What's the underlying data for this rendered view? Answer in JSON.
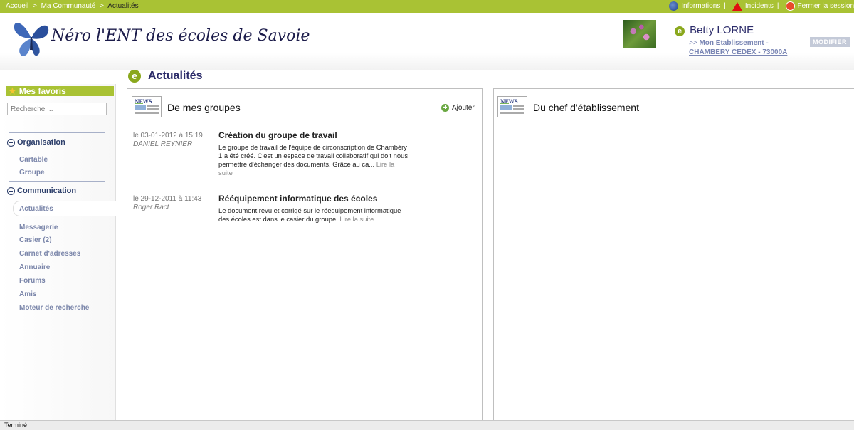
{
  "topbar": {
    "breadcrumb": [
      "Accueil",
      "Ma Communauté",
      "Actualités"
    ],
    "breadcrumb_sep": ">",
    "links": {
      "info": "Informations",
      "incidents": "Incidents",
      "logout": "Fermer la session"
    },
    "pipe": "|"
  },
  "header": {
    "brand": "Néro l'ENT des écoles de Savoie",
    "user": {
      "name": "Betty LORNE",
      "prefix": ">>",
      "etablissement_link": "Mon Etablissement -",
      "location": "CHAMBERY CEDEX - 73000A",
      "modify_label": "MODIFIER"
    }
  },
  "page": {
    "title": "Actualités",
    "badge": "e"
  },
  "sidebar": {
    "favorites_title": "Mes favoris",
    "search_placeholder": "Recherche ...",
    "sections": [
      {
        "title": "Organisation",
        "items": [
          "Cartable",
          "Groupe"
        ]
      },
      {
        "title": "Communication",
        "items": [
          "Actualités",
          "Messagerie",
          "Casier (2)",
          "Carnet d'adresses",
          "Annuaire",
          "Forums",
          "Amis",
          "Moteur de recherche"
        ]
      }
    ],
    "active_item": "Actualités"
  },
  "panels": {
    "groups": {
      "title": "De mes groupes",
      "add_label": "Ajouter",
      "articles": [
        {
          "date": "le 03-01-2012 à 15:19",
          "author": "DANIEL REYNIER",
          "title": "Création du groupe de travail",
          "body": "Le groupe de travail de l'équipe de circonscription de Chambéry 1 a été créé. C'est un espace de travail collaboratif qui doit nous permettre d'échanger des documents. Grâce au ca...",
          "more": "Lire la suite"
        },
        {
          "date": "le 29-12-2011 à 11:43",
          "author": "Roger Ract",
          "title": "Rééquipement informatique des écoles",
          "body": "Le document revu et corrigé sur le rééquipement informatique des écoles est dans le casier du groupe.",
          "more": "Lire la suite"
        }
      ]
    },
    "principal": {
      "title": "Du chef d'établissement"
    }
  },
  "news_icon_text": "NEWS",
  "statusbar": {
    "text": "Terminé"
  }
}
